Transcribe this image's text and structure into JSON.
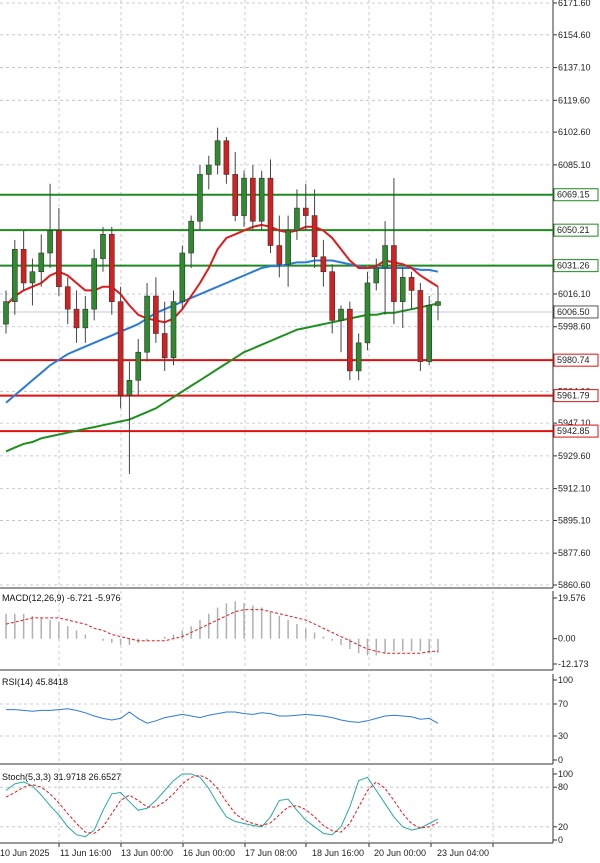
{
  "main": {
    "price_ticks": [
      "6171.60",
      "6154.60",
      "6137.10",
      "6119.60",
      "6102.60",
      "6085.10",
      "6016.10",
      "5998.60",
      "5929.60",
      "5912.10",
      "5895.10",
      "5877.60",
      "5860.60"
    ],
    "partial_ticks": [
      "5964.10",
      "5947.10"
    ],
    "price_min": 5860.6,
    "price_max": 6171.6,
    "levels": [
      {
        "label": "6069.15",
        "value": 6069.15,
        "color": "#1f8a1f"
      },
      {
        "label": "6050.21",
        "value": 6050.21,
        "color": "#1f8a1f"
      },
      {
        "label": "6031.26",
        "value": 6031.26,
        "color": "#1f8a1f"
      },
      {
        "label": "5980.74",
        "value": 5980.74,
        "color": "#e01010"
      },
      {
        "label": "5961.79",
        "value": 5961.79,
        "color": "#e01010"
      },
      {
        "label": "5942.85",
        "value": 5942.85,
        "color": "#e01010"
      }
    ],
    "current_price": {
      "label": "6006.50",
      "value": 6006.5
    },
    "colors": {
      "up": "#2e8b2e",
      "down": "#d42020",
      "ma_fast": "#e31a1c",
      "ma_mid": "#2b7bd6",
      "ma_slow": "#1e8f1e",
      "grid": "#b8bfd0"
    }
  },
  "x_labels": [
    "10 Jun 2025",
    "11 Jun 16:00",
    "13 Jun 00:00",
    "16 Jun 00:00",
    "17 Jun 08:00",
    "18 Jun 16:00",
    "20 Jun 00:00",
    "23 Jun 04:00"
  ],
  "macd": {
    "title": "MACD(12,26,9) -6.721 -5.976",
    "ticks": [
      "19.576",
      "0.00",
      "-12.173"
    ],
    "ymin": -12.173,
    "ymax": 19.576
  },
  "rsi": {
    "title": "RSI(14) 45.8418",
    "ticks": [
      "100",
      "70",
      "30",
      "0"
    ],
    "line_color": "#2b7bd6"
  },
  "stoch": {
    "title": "Stoch(5,3,3) 31.9718 26.6527",
    "ticks": [
      "100",
      "80",
      "20",
      "0"
    ],
    "main_color": "#2aa6a6",
    "signal_color": "#e31a1c"
  },
  "chart_data": [
    {
      "type": "candlestick",
      "x": [
        "10 Jun 2025",
        "11 Jun 16:00",
        "13 Jun 00:00",
        "16 Jun 00:00",
        "17 Jun 08:00",
        "18 Jun 16:00",
        "20 Jun 00:00",
        "23 Jun 04:00"
      ],
      "ylim": [
        5860.6,
        6171.6
      ],
      "ohlc": [
        [
          6000,
          6018,
          5995,
          6012
        ],
        [
          6012,
          6045,
          6005,
          6040
        ],
        [
          6040,
          6050,
          6018,
          6022
        ],
        [
          6022,
          6035,
          6010,
          6028
        ],
        [
          6028,
          6048,
          6020,
          6038
        ],
        [
          6038,
          6075,
          6030,
          6050
        ],
        [
          6050,
          6062,
          6015,
          6020
        ],
        [
          6020,
          6025,
          6000,
          6008
        ],
        [
          6008,
          6018,
          5990,
          5998
        ],
        [
          5998,
          6015,
          5990,
          6008
        ],
        [
          6008,
          6040,
          6002,
          6035
        ],
        [
          6035,
          6052,
          6028,
          6048
        ],
        [
          6048,
          6052,
          6005,
          6012
        ],
        [
          6012,
          6020,
          5955,
          5962
        ],
        [
          5962,
          5980,
          5920,
          5970
        ],
        [
          5970,
          5992,
          5962,
          5985
        ],
        [
          5985,
          6022,
          5980,
          6015
        ],
        [
          6015,
          6025,
          5990,
          5995
        ],
        [
          5995,
          6012,
          5975,
          5982
        ],
        [
          5982,
          6018,
          5978,
          6012
        ],
        [
          6012,
          6042,
          6008,
          6038
        ],
        [
          6038,
          6058,
          6030,
          6055
        ],
        [
          6055,
          6085,
          6050,
          6080
        ],
        [
          6080,
          6090,
          6072,
          6085
        ],
        [
          6085,
          6105,
          6080,
          6098
        ],
        [
          6098,
          6100,
          6075,
          6080
        ],
        [
          6080,
          6092,
          6055,
          6058
        ],
        [
          6058,
          6082,
          6052,
          6078
        ],
        [
          6078,
          6085,
          6050,
          6055
        ],
        [
          6055,
          6082,
          6050,
          6078
        ],
        [
          6078,
          6088,
          6038,
          6042
        ],
        [
          6042,
          6058,
          6025,
          6032
        ],
        [
          6032,
          6058,
          6020,
          6050
        ],
        [
          6050,
          6072,
          6045,
          6062
        ],
        [
          6062,
          6075,
          6050,
          6058
        ],
        [
          6058,
          6072,
          6030,
          6036
        ],
        [
          6036,
          6045,
          6020,
          6028
        ],
        [
          6028,
          6032,
          5995,
          6002
        ],
        [
          6002,
          6010,
          5985,
          6008
        ],
        [
          6008,
          6012,
          5970,
          5975
        ],
        [
          5975,
          5995,
          5970,
          5990
        ],
        [
          5990,
          6028,
          5986,
          6022
        ],
        [
          6022,
          6035,
          6018,
          6030
        ],
        [
          6030,
          6055,
          6005,
          6042
        ],
        [
          6042,
          6078,
          6000,
          6012
        ],
        [
          6012,
          6030,
          5998,
          6025
        ],
        [
          6025,
          6028,
          6008,
          6018
        ],
        [
          6018,
          6022,
          5975,
          5980
        ],
        [
          5980,
          6015,
          5978,
          6010
        ],
        [
          6010,
          6020,
          6002,
          6012
        ]
      ],
      "ma_fast": [
        6010,
        6015,
        6018,
        6020,
        6022,
        6026,
        6028,
        6026,
        6022,
        6018,
        6018,
        6020,
        6020,
        6016,
        6010,
        6005,
        6003,
        6002,
        6001,
        6003,
        6008,
        6015,
        6022,
        6030,
        6040,
        6046,
        6048,
        6050,
        6052,
        6053,
        6052,
        6050,
        6049,
        6050,
        6052,
        6052,
        6050,
        6046,
        6040,
        6034,
        6030,
        6030,
        6031,
        6034,
        6033,
        6032,
        6030,
        6026,
        6023,
        6020
      ],
      "ma_mid": [
        5958,
        5962,
        5966,
        5970,
        5974,
        5978,
        5981,
        5984,
        5986,
        5988,
        5990,
        5992,
        5994,
        5996,
        5998,
        6000,
        6003,
        6006,
        6008,
        6010,
        6012,
        6014,
        6016,
        6018,
        6020,
        6022,
        6024,
        6026,
        6028,
        6030,
        6031,
        6031,
        6032,
        6033,
        6033,
        6034,
        6034,
        6034,
        6033,
        6032,
        6031,
        6030,
        6030,
        6030,
        6030,
        6030,
        6030,
        6029,
        6029,
        6028
      ],
      "ma_slow": [
        5932,
        5934,
        5936,
        5937,
        5939,
        5940,
        5941,
        5942,
        5943,
        5944,
        5945,
        5946,
        5947,
        5948,
        5949,
        5951,
        5953,
        5955,
        5958,
        5961,
        5964,
        5967,
        5970,
        5973,
        5976,
        5979,
        5982,
        5985,
        5987,
        5989,
        5991,
        5993,
        5995,
        5997,
        5998,
        5999,
        6000,
        6001,
        6002,
        6003,
        6004,
        6005,
        6005,
        6006,
        6006,
        6007,
        6008,
        6009,
        6010,
        6011
      ]
    },
    {
      "type": "bar",
      "name": "MACD",
      "ylim": [
        -12.173,
        19.576
      ],
      "values": [
        12,
        12,
        12,
        11,
        10,
        9,
        8,
        6,
        4,
        2,
        0,
        -1,
        -2,
        -3,
        -3,
        -2,
        -1,
        0,
        1,
        2,
        4,
        6,
        9,
        12,
        15,
        17,
        18,
        17,
        16,
        15,
        13,
        11,
        9,
        7,
        5,
        3,
        1,
        -1,
        -3,
        -5,
        -7,
        -8,
        -8,
        -7,
        -6,
        -6,
        -6,
        -6,
        -7,
        -6.721
      ],
      "signal": [
        7,
        8,
        9,
        10,
        10,
        10,
        10,
        9,
        8,
        7,
        5,
        4,
        2,
        1,
        0,
        -1,
        -1,
        -1,
        -1,
        0,
        1,
        3,
        5,
        7,
        9,
        11,
        13,
        14,
        14,
        14,
        13,
        12,
        11,
        10,
        9,
        7,
        5,
        3,
        1,
        -1,
        -3,
        -5,
        -6,
        -7,
        -7,
        -7,
        -7,
        -7,
        -6.2,
        -5.976
      ]
    },
    {
      "type": "line",
      "name": "RSI(14)",
      "ylim": [
        0,
        100
      ],
      "values": [
        63,
        63,
        62,
        61,
        62,
        62,
        63,
        64,
        62,
        59,
        55,
        52,
        50,
        52,
        60,
        52,
        46,
        49,
        53,
        55,
        57,
        55,
        53,
        56,
        58,
        60,
        60,
        58,
        57,
        59,
        58,
        55,
        55,
        56,
        57,
        56,
        55,
        53,
        50,
        48,
        47,
        49,
        52,
        55,
        56,
        55,
        54,
        51,
        52,
        45.8418
      ]
    },
    {
      "type": "line",
      "name": "Stoch(5,3,3)",
      "ylim": [
        0,
        100
      ],
      "main": [
        75,
        85,
        88,
        82,
        68,
        52,
        38,
        20,
        8,
        5,
        15,
        45,
        70,
        72,
        58,
        45,
        48,
        60,
        75,
        90,
        100,
        100,
        95,
        78,
        55,
        35,
        28,
        25,
        22,
        20,
        35,
        60,
        62,
        45,
        30,
        20,
        10,
        8,
        20,
        50,
        90,
        95,
        75,
        55,
        35,
        20,
        15,
        18,
        25,
        31.9718
      ],
      "signal": [
        65,
        72,
        80,
        84,
        80,
        70,
        56,
        40,
        25,
        12,
        10,
        20,
        40,
        60,
        68,
        60,
        50,
        50,
        58,
        70,
        85,
        95,
        98,
        92,
        78,
        58,
        40,
        30,
        25,
        22,
        26,
        38,
        50,
        52,
        46,
        35,
        22,
        14,
        12,
        25,
        50,
        75,
        88,
        78,
        60,
        40,
        25,
        18,
        20,
        26.6527
      ]
    }
  ]
}
